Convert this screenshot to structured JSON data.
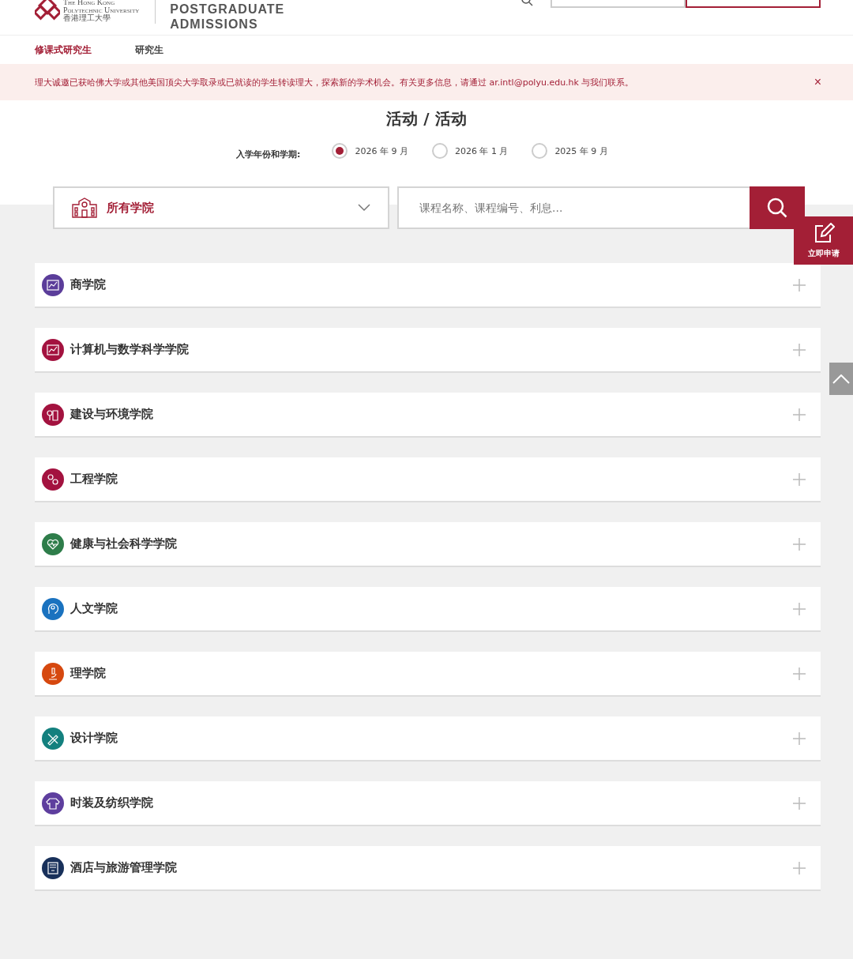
{
  "header": {
    "university_name_en": [
      "The Hong Kong",
      "Polytechnic University"
    ],
    "university_name_zh": "香港理工大學",
    "site_title": [
      "POSTGRADUATE",
      "ADMISSIONS"
    ]
  },
  "subnav": [
    {
      "label": "修课式研究生",
      "selected": true
    },
    {
      "label": "研究生",
      "selected": false
    }
  ],
  "notice": {
    "text": "理大诚邀已获哈佛大学或其他美国顶尖大学取录或已就读的学生转读理大，探索新的学术机会。有关更多信息，请通过 ar.intl@polyu.edu.hk 与我们联系。",
    "close": "×"
  },
  "page_title": "活动 / 活动",
  "intake": {
    "label": "入学年份和学期:",
    "options": [
      {
        "label": "2026 年 9 月",
        "selected": true
      },
      {
        "label": "2026 年 1 月",
        "selected": false
      },
      {
        "label": "2025 年 9 月",
        "selected": false
      }
    ]
  },
  "faculty_select": {
    "value": "所有学院"
  },
  "search": {
    "placeholder": "课程名称、课程编号、利息..."
  },
  "apply_button": "立即申请",
  "faculties": [
    {
      "name": "商学院",
      "color": "#5b3d9a",
      "kind": "chart"
    },
    {
      "name": "计算机与数学科学学院",
      "color": "#a3123f",
      "kind": "chart"
    },
    {
      "name": "建设与环境学院",
      "color": "#a3123f",
      "kind": "building"
    },
    {
      "name": "工程学院",
      "color": "#a3123f",
      "kind": "gears"
    },
    {
      "name": "健康与社会科学学院",
      "color": "#2e7d4a",
      "kind": "heart"
    },
    {
      "name": "人文学院",
      "color": "#1a72bf",
      "kind": "head"
    },
    {
      "name": "理学院",
      "color": "#d6480f",
      "kind": "microscope"
    },
    {
      "name": "设计学院",
      "color": "#13807e",
      "kind": "pencil"
    },
    {
      "name": "时装及纺织学院",
      "color": "#5e3e9e",
      "kind": "shirt"
    },
    {
      "name": "酒店与旅游管理学院",
      "color": "#18305a",
      "kind": "hotel"
    }
  ]
}
